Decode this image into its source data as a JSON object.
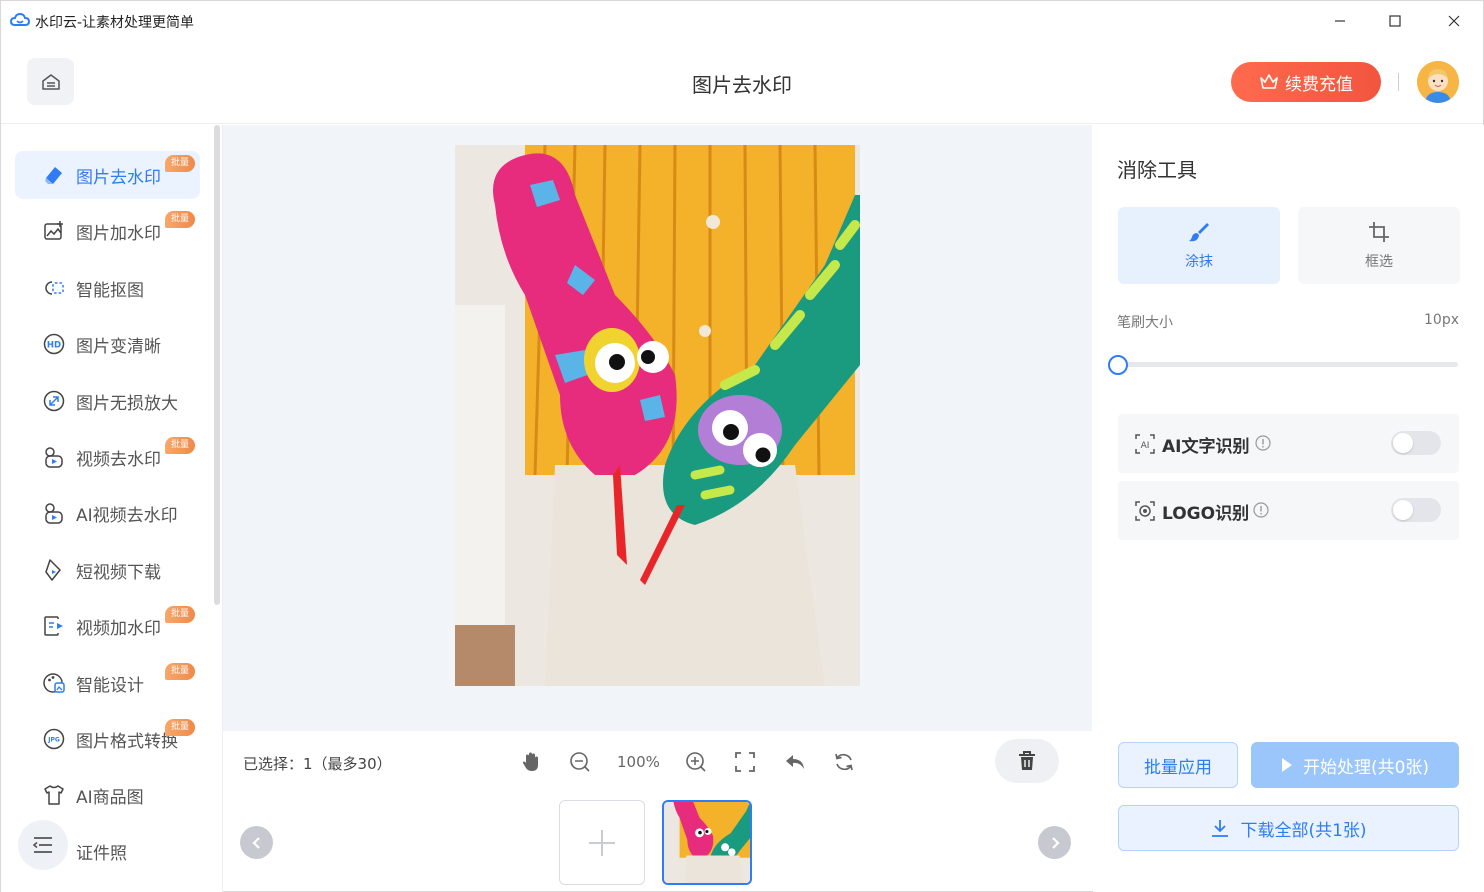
{
  "window": {
    "title": "水印云-让素材处理更简单",
    "controls": [
      "minimize-icon",
      "maximize-icon",
      "close-icon"
    ]
  },
  "header": {
    "page_title": "图片去水印",
    "recharge_label": "续费充值",
    "home_icon": "home-icon"
  },
  "sidebar": {
    "items": [
      {
        "label": "图片去水印",
        "icon": "eraser-icon",
        "badge": "批量",
        "active": true
      },
      {
        "label": "图片加水印",
        "icon": "image-add-icon",
        "badge": "批量",
        "active": false
      },
      {
        "label": "智能抠图",
        "icon": "cutout-icon",
        "badge": "",
        "active": false
      },
      {
        "label": "图片变清晰",
        "icon": "hd-icon",
        "badge": "",
        "active": false
      },
      {
        "label": "图片无损放大",
        "icon": "enlarge-icon",
        "badge": "",
        "active": false
      },
      {
        "label": "视频去水印",
        "icon": "video-erase-icon",
        "badge": "批量",
        "active": false
      },
      {
        "label": "AI视频去水印",
        "icon": "ai-video-icon",
        "badge": "",
        "active": false
      },
      {
        "label": "短视频下载",
        "icon": "video-download-icon",
        "badge": "",
        "active": false
      },
      {
        "label": "视频加水印",
        "icon": "video-add-icon",
        "badge": "批量",
        "active": false
      },
      {
        "label": "智能设计",
        "icon": "design-icon",
        "badge": "批量",
        "active": false
      },
      {
        "label": "图片格式转换",
        "icon": "jpg-convert-icon",
        "badge": "批量",
        "active": false
      },
      {
        "label": "AI商品图",
        "icon": "tshirt-icon",
        "badge": "",
        "active": false
      },
      {
        "label": "证件照",
        "icon": "id-photo-icon",
        "badge": "",
        "active": false
      }
    ]
  },
  "workspace": {
    "selected_text": "已选择：1（最多30）",
    "zoom": "100%",
    "tools": [
      "hand-icon",
      "zoom-out-icon",
      "zoom-in-icon",
      "fullscreen-icon",
      "undo-icon",
      "refresh-icon"
    ]
  },
  "panel": {
    "title": "消除工具",
    "tools": [
      {
        "label": "涂抹",
        "icon": "brush-icon",
        "active": true
      },
      {
        "label": "框选",
        "icon": "crop-icon",
        "active": false
      }
    ],
    "brush_label": "笔刷大小",
    "brush_value": "10px",
    "brush_level": 0,
    "toggles": [
      {
        "label": "AI文字识别",
        "icon": "ai-text-icon",
        "on": false
      },
      {
        "label": "LOGO识别",
        "icon": "logo-scan-icon",
        "on": false
      }
    ],
    "batch_apply": "批量应用",
    "start_process": "开始处理(共0张)",
    "download_all": "下载全部(共1张)"
  },
  "colors": {
    "accent": "#2f7cf6",
    "recharge": "#f2553e",
    "badge": "#f08948"
  }
}
